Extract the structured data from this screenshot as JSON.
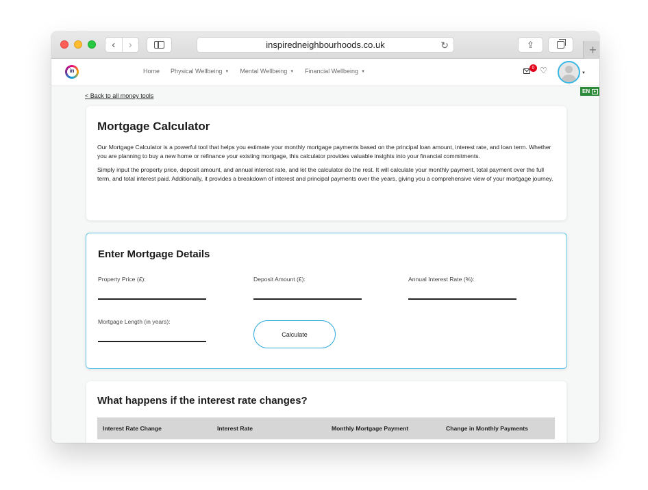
{
  "browser": {
    "url": "inspiredneighbourhoods.co.uk",
    "new_tab_symbol": "+"
  },
  "site": {
    "logo_text": "in",
    "nav": [
      "Home",
      "Physical Wellbeing",
      "Mental Wellbeing",
      "Financial Wellbeing"
    ],
    "messages_badge": "0",
    "language": "EN"
  },
  "page": {
    "back_link": "< Back to all money tools",
    "intro": {
      "title": "Mortgage Calculator",
      "paragraph_1": "Our Mortgage Calculator is a powerful tool that helps you estimate your monthly mortgage payments based on the principal loan amount, interest rate, and loan term. Whether you are planning to buy a new home or refinance your existing mortgage, this calculator provides valuable insights into your financial commitments.",
      "paragraph_2": "Simply input the property price, deposit amount, and annual interest rate, and let the calculator do the rest. It will calculate your monthly payment, total payment over the full term, and total interest paid. Additionally, it provides a breakdown of interest and principal payments over the years, giving you a comprehensive view of your mortgage journey."
    },
    "details": {
      "title": "Enter Mortgage Details",
      "property_price_label": "Property Price (£):",
      "deposit_label": "Deposit Amount (£):",
      "interest_rate_label": "Annual Interest Rate (%):",
      "length_label": "Mortgage Length (in years):",
      "calculate_label": "Calculate"
    },
    "rate_changes": {
      "title": "What happens if the interest rate changes?",
      "columns": [
        "Interest Rate Change",
        "Interest Rate",
        "Monthly Mortgage Payment",
        "Change in Monthly Payments"
      ]
    }
  }
}
